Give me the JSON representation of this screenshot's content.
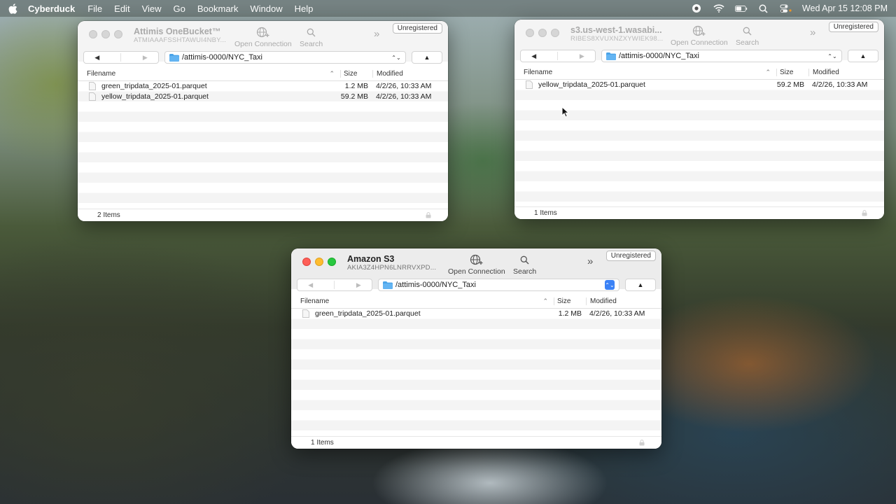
{
  "menubar": {
    "app": "Cyberduck",
    "items": [
      "File",
      "Edit",
      "View",
      "Go",
      "Bookmark",
      "Window",
      "Help"
    ],
    "clock": "Wed Apr 15  12:08 PM"
  },
  "toolbar": {
    "open_connection": "Open Connection",
    "search": "Search",
    "more": "»",
    "unregistered": "Unregistered",
    "back": "◀",
    "forward": "▶",
    "up": "▲",
    "updown": "⌃⌄"
  },
  "columns": {
    "filename": "Filename",
    "size": "Size",
    "modified": "Modified",
    "sort": "⌃"
  },
  "windows": [
    {
      "title": "Attimis OneBucket™",
      "subtitle": "ATMIAAAFSSHTAWUI4NBY...",
      "path": "/attimis-0000/NYC_Taxi",
      "files": [
        {
          "name": "green_tripdata_2025-01.parquet",
          "size": "1.2 MB",
          "modified": "4/2/26, 10:33 AM"
        },
        {
          "name": "yellow_tripdata_2025-01.parquet",
          "size": "59.2 MB",
          "modified": "4/2/26, 10:33 AM"
        }
      ],
      "status": "2 Items"
    },
    {
      "title": "s3.us-west-1.wasabi...",
      "subtitle": "RIBES8XVUXNZXYWIEK98...",
      "path": "/attimis-0000/NYC_Taxi",
      "files": [
        {
          "name": "yellow_tripdata_2025-01.parquet",
          "size": "59.2 MB",
          "modified": "4/2/26, 10:33 AM"
        }
      ],
      "status": "1 Items"
    },
    {
      "title": "Amazon S3",
      "subtitle": "AKIA3Z4HPN6LNRRVXPD...",
      "path": "/attimis-0000/NYC_Taxi",
      "files": [
        {
          "name": "green_tripdata_2025-01.parquet",
          "size": "1.2 MB",
          "modified": "4/2/26, 10:33 AM"
        }
      ],
      "status": "1 Items"
    }
  ]
}
